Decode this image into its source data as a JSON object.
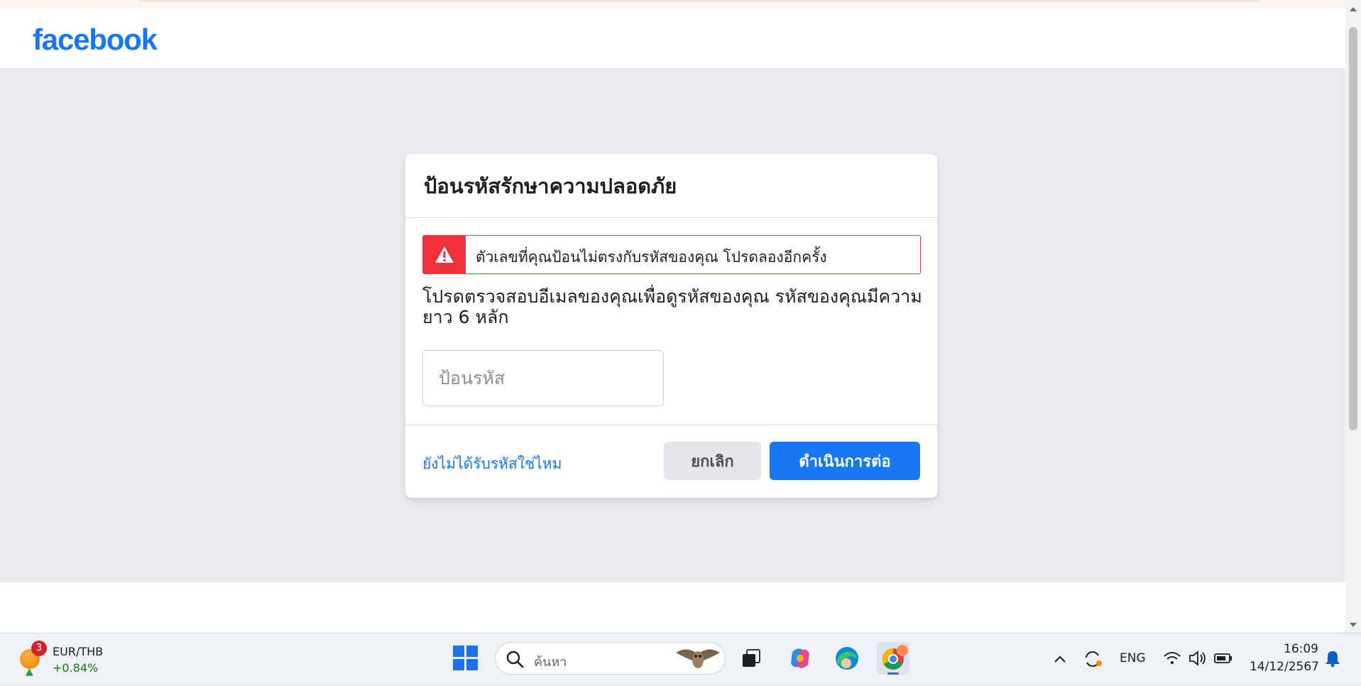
{
  "header": {
    "logo": "facebook"
  },
  "dialog": {
    "title": "ป้อนรหัสรักษาความปลอดภัย",
    "error_message": "ตัวเลขที่คุณป้อนไม่ตรงกับรหัสของคุณ โปรดลองอีกครั้ง",
    "instructions": "โปรดตรวจสอบอีเมลของคุณเพื่อดูรหัสของคุณ รหัสของคุณมีความยาว 6 หลัก",
    "code_input": {
      "value": "",
      "placeholder": "ป้อนรหัส"
    },
    "resend_link": "ยังไม่ได้รับรหัสใช่ไหม",
    "cancel_label": "ยกเลิก",
    "continue_label": "ดำเนินการต่อ"
  },
  "colors": {
    "brand": "#1877f2",
    "error": "#f2303a",
    "background": "#e9ebee"
  },
  "taskbar": {
    "widget": {
      "badge": "3",
      "pair": "EUR/THB",
      "change": "+0.84%"
    },
    "search_placeholder": "ค้นหา",
    "language": "ENG",
    "time": "16:09",
    "date": "14/12/2567",
    "icons": [
      "start-icon",
      "search-icon",
      "task-view-icon",
      "copilot-icon",
      "edge-icon",
      "chrome-icon",
      "chevron-up-icon",
      "sync-icon",
      "wifi-icon",
      "volume-icon",
      "battery-icon",
      "bell-icon"
    ]
  }
}
